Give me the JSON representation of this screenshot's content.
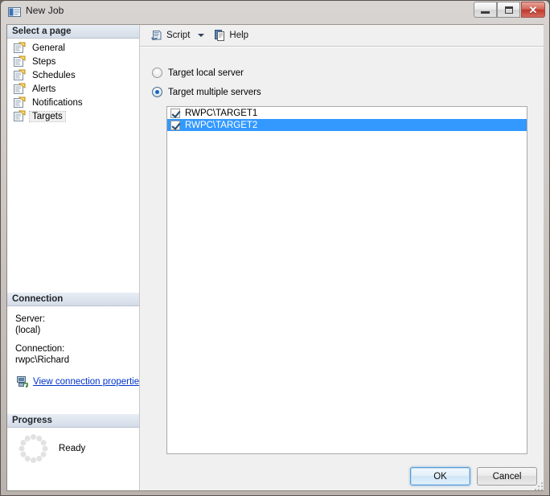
{
  "window": {
    "title": "New Job",
    "icon": "job-window-icon",
    "controls": {
      "minimize_label": "Minimize",
      "maximize_label": "Maximize",
      "close_label": "Close",
      "close_glyph": "✕"
    }
  },
  "sidebar": {
    "select_page_header": "Select a page",
    "items": [
      {
        "label": "General",
        "icon": "page-icon",
        "selected": false
      },
      {
        "label": "Steps",
        "icon": "page-icon",
        "selected": false
      },
      {
        "label": "Schedules",
        "icon": "page-icon",
        "selected": false
      },
      {
        "label": "Alerts",
        "icon": "page-icon",
        "selected": false
      },
      {
        "label": "Notifications",
        "icon": "page-icon",
        "selected": false
      },
      {
        "label": "Targets",
        "icon": "page-icon",
        "selected": true
      }
    ],
    "connection": {
      "header": "Connection",
      "server_label": "Server:",
      "server_value": "(local)",
      "connection_label": "Connection:",
      "connection_value": "rwpc\\Richard",
      "link_text": "View connection properties",
      "link_icon": "server-connection-icon",
      "link_color": "#0033cc"
    },
    "progress": {
      "header": "Progress",
      "status": "Ready",
      "spinner_icon": "loading-spinner-icon"
    }
  },
  "toolbar": {
    "script_label": "Script",
    "script_icon": "script-icon",
    "dropdown_icon": "chevron-down-icon",
    "help_label": "Help",
    "help_icon": "help-book-icon"
  },
  "main": {
    "options": [
      {
        "label": "Target local server",
        "checked": false
      },
      {
        "label": "Target multiple servers",
        "checked": true
      }
    ],
    "server_list": [
      {
        "label": "RWPC\\TARGET1",
        "checked": true,
        "selected": false
      },
      {
        "label": "RWPC\\TARGET2",
        "checked": true,
        "selected": true
      }
    ],
    "selection_color": "#3399ff"
  },
  "footer": {
    "ok_label": "OK",
    "cancel_label": "Cancel"
  }
}
